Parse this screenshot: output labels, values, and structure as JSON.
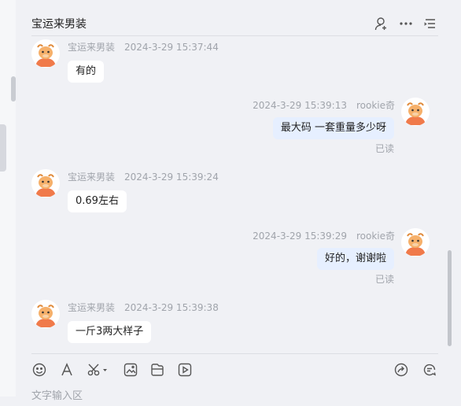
{
  "chat": {
    "title": "宝运来男装",
    "read_label": "已读",
    "input_placeholder": "文字输入区"
  },
  "messages": [
    {
      "direction": "in",
      "sender": "宝运来男装",
      "time": "2024-3-29 15:37:44",
      "text": "有的"
    },
    {
      "direction": "out",
      "sender": "rookie奇",
      "time": "2024-3-29 15:39:13",
      "text": "最大码 一套重量多少呀",
      "status": "已读"
    },
    {
      "direction": "in",
      "sender": "宝运来男装",
      "time": "2024-3-29 15:39:24",
      "text": "0.69左右"
    },
    {
      "direction": "out",
      "sender": "rookie奇",
      "time": "2024-3-29 15:39:29",
      "text": "好的，谢谢啦",
      "status": "已读"
    },
    {
      "direction": "in",
      "sender": "宝运来男装",
      "time": "2024-3-29 15:39:38",
      "text": "一斤3两大样子"
    }
  ],
  "icons": {
    "header": [
      "add-contact-icon",
      "more-icon",
      "list-icon"
    ],
    "composer": [
      "emoji-icon",
      "font-icon",
      "scissors-icon",
      "image-icon",
      "file-icon",
      "video-icon",
      "share-icon",
      "quick-reply-icon"
    ]
  },
  "colors": {
    "background": "#f0f1f5",
    "incoming_bubble": "#ffffff",
    "outgoing_bubble": "#e6efff",
    "avatar_accent": "#f07a4a"
  }
}
